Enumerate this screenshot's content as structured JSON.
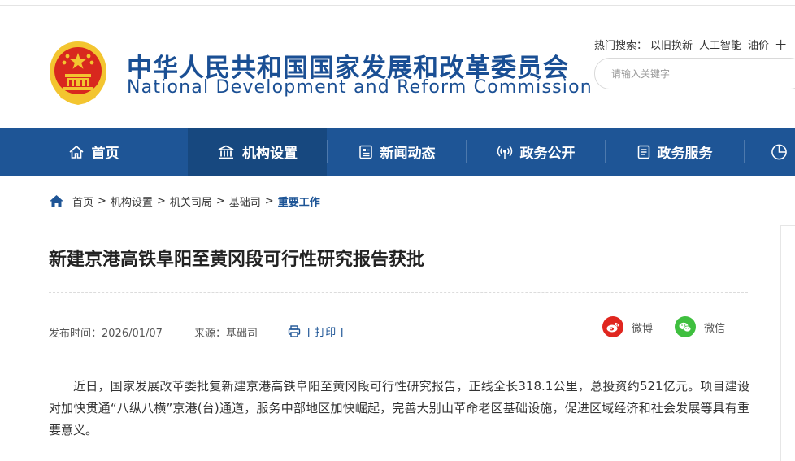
{
  "header": {
    "title_cn": "中华人民共和国国家发展和改革委员会",
    "title_en": "National Development and Reform Commission",
    "hot_label": "热门搜索：",
    "hot_keywords": [
      "以旧换新",
      "人工智能",
      "油价",
      "十"
    ],
    "search_placeholder": "请输入关键字"
  },
  "nav": {
    "items": [
      {
        "label": "首页",
        "icon": "home-icon"
      },
      {
        "label": "机构设置",
        "icon": "institution-icon"
      },
      {
        "label": "新闻动态",
        "icon": "news-icon"
      },
      {
        "label": "政务公开",
        "icon": "broadcast-icon"
      },
      {
        "label": "政务服务",
        "icon": "service-icon"
      },
      {
        "label": "",
        "icon": "chart-icon"
      }
    ],
    "active_index": 1
  },
  "breadcrumb": {
    "items": [
      "首页",
      "机构设置",
      "机关司局",
      "基础司"
    ],
    "current": "重要工作",
    "separator": ">"
  },
  "article": {
    "title": "新建京港高铁阜阳至黄冈段可行性研究报告获批",
    "date": "发布时间：2026/01/07",
    "source": "来源：基础司",
    "print_label": "[ 打印 ]",
    "share_weibo": "微博",
    "share_wechat": "微信",
    "body": "近日，国家发展改革委批复新建京港高铁阜阳至黄冈段可行性研究报告，正线全长318.1公里，总投资约521亿元。项目建设对加快贯通“八纵八横”京港(台)通道，服务中部地区加快崛起，完善大别山革命老区基础设施，促进区域经济和社会发展等具有重要意义。"
  },
  "colors": {
    "brand_blue": "#1e5596",
    "nav_active": "#17487f",
    "emblem_red": "#d8281e",
    "emblem_gold": "#f3c530",
    "weibo_red": "#e0261f",
    "wechat_green": "#3fbf3f"
  }
}
